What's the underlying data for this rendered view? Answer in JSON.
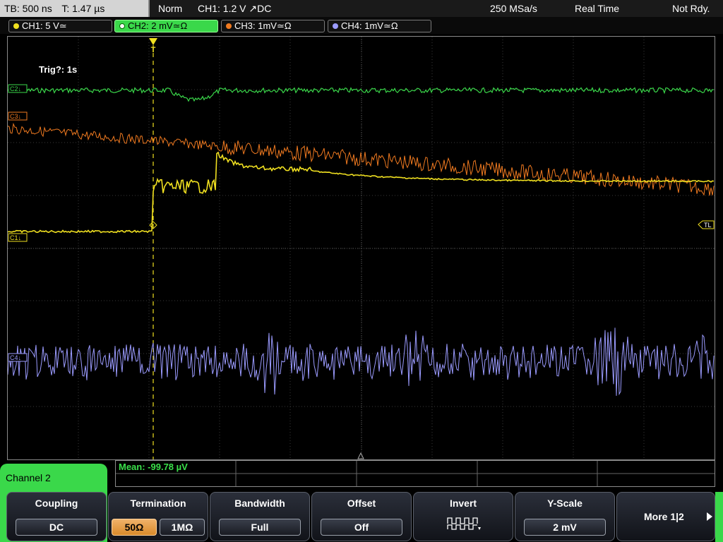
{
  "status": {
    "timebase": "TB: 500 ns",
    "trigger_time": "T: 1.47 µs",
    "mode": "Norm",
    "trigger": "CH1: 1.2 V ↗DC",
    "sample_rate": "250 MSa/s",
    "acq_mode": "Real Time",
    "state": "Not Rdy."
  },
  "channels": [
    {
      "label": "CH1: 5 V≃",
      "color": "#f0e020"
    },
    {
      "label": "CH2: 2 mV≃Ω",
      "color": "#3ad84a"
    },
    {
      "label": "CH3: 1mV≃Ω",
      "color": "#f07a20"
    },
    {
      "label": "CH4: 1mV≃Ω",
      "color": "#9b9bff"
    }
  ],
  "screen": {
    "trigger_info": "Trig?: 1s",
    "markers": {
      "ch1": "C1↓",
      "ch2": "C2↓",
      "ch3": "C3↓",
      "ch4": "C4↓",
      "trigger_level": "TL",
      "trigger_pos": "T"
    }
  },
  "measurement": {
    "label": "Mean: -99.78 µV"
  },
  "channel_menu": {
    "title": "Channel 2"
  },
  "softkeys": {
    "coupling": {
      "title": "Coupling",
      "value": "DC"
    },
    "termination": {
      "title": "Termination",
      "option1": "50Ω",
      "option2": "1MΩ",
      "selected": "50Ω"
    },
    "bandwidth": {
      "title": "Bandwidth",
      "value": "Full"
    },
    "offset": {
      "title": "Offset",
      "value": "Off"
    },
    "invert": {
      "title": "Invert",
      "icon": "invert-pulse-icon"
    },
    "yscale": {
      "title": "Y-Scale",
      "value": "2 mV"
    },
    "more": {
      "label": "More 1|2",
      "icon": "arrow-right-icon"
    }
  },
  "colors": {
    "ch1": "#f0e020",
    "ch2": "#3ad84a",
    "ch3": "#f07a20",
    "ch4": "#9b9bff",
    "menu_green": "#3ad84a"
  }
}
